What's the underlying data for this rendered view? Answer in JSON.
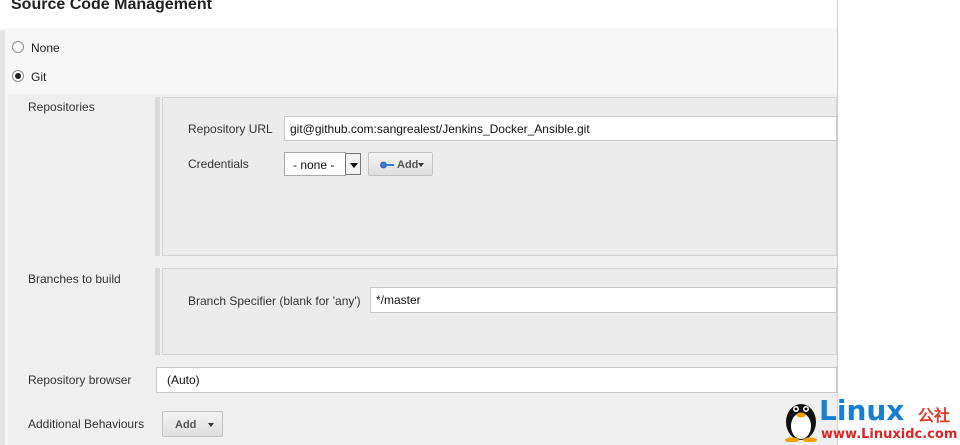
{
  "section": {
    "title": "Source Code Management"
  },
  "scm_options": [
    {
      "label": "None",
      "checked": false
    },
    {
      "label": "Git",
      "checked": true
    }
  ],
  "repositories": {
    "label": "Repositories",
    "url_label": "Repository URL",
    "url_value": "git@github.com:sangrealest/Jenkins_Docker_Ansible.git",
    "credentials_label": "Credentials",
    "credentials_value": "- none -",
    "add_label": "Add"
  },
  "branches": {
    "label": "Branches to build",
    "specifier_label": "Branch Specifier (blank for 'any')",
    "specifier_value": "*/master"
  },
  "repository_browser": {
    "label": "Repository browser",
    "value": "(Auto)"
  },
  "additional_behaviours": {
    "label": "Additional Behaviours",
    "add_label": "Add"
  },
  "watermark": {
    "brand": "Linux",
    "brand_cn": "公社",
    "url": "www.Linuxidc.com"
  },
  "colors": {
    "brand_blue": "#1a7fd0",
    "brand_red": "#d92525"
  }
}
